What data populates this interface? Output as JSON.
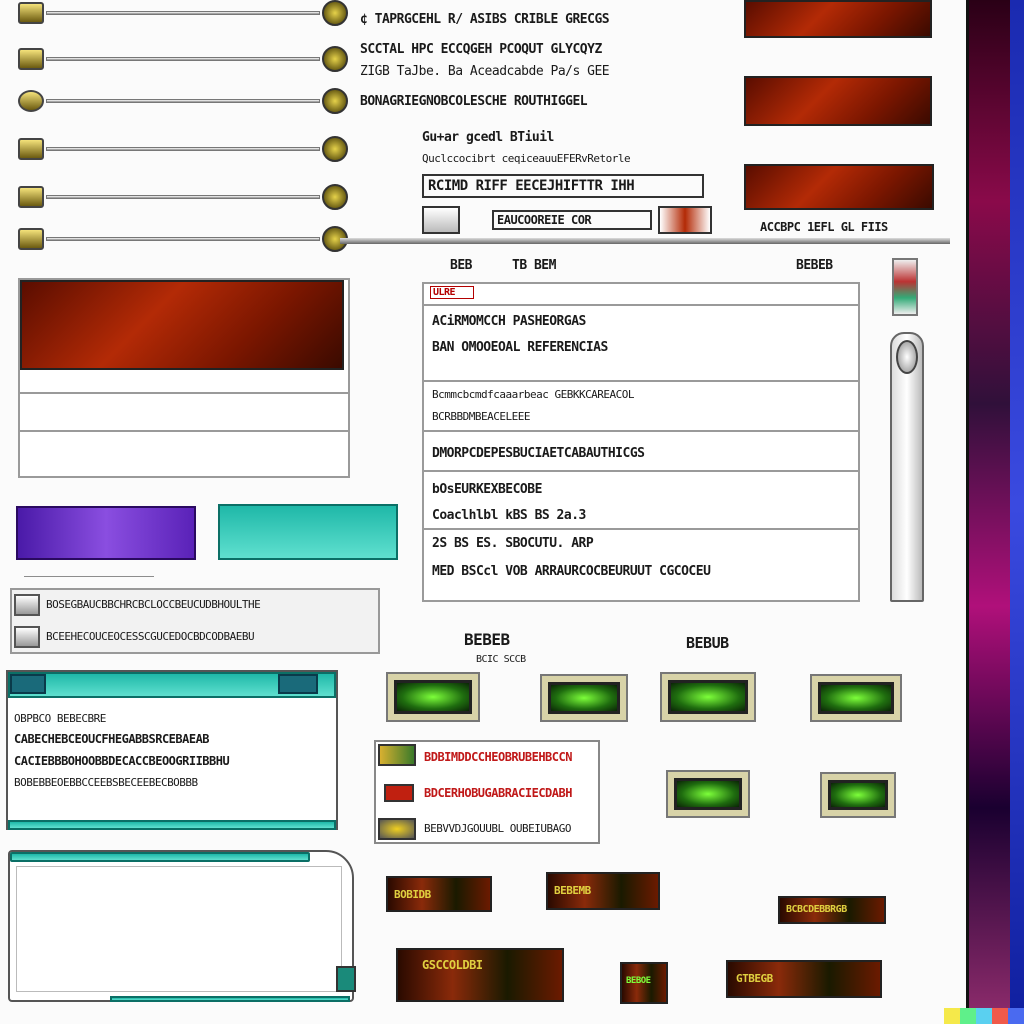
{
  "top_text": {
    "line1": "¢ TAPRGCEHL R/ ASIBS CRIBLE GRECGS",
    "line2": "SCCTAL HPC ECCQGEH PCOQUT GLYCQYZ",
    "line3": "ZIGB TaJbe. Ba Aceadcabde Pa/s GEE",
    "line4": "BONAGRIEGNOBCOLESCHE ROUTHIGGEL"
  },
  "mid_labels": {
    "m1": "Gu+ar gcedl BTiuil",
    "m2": "Quclccocibrt   ceqiceauuEFERvRetorle",
    "m3": "RCIMD RIFF EECEJHIFTTR IHH",
    "m4": "EAUCOOREIE COR"
  },
  "right_caption": "ACCBPC 1EFL GL FIIS",
  "main_panel": {
    "header_left": "BEB",
    "header_mid": "TB BEM",
    "header_right": "BEBEB",
    "tag": "ULRE",
    "rows": [
      "ACiRMOMCCH PASHEORGAS",
      "BAN OMOOEOAL REFERENCIAS",
      "Bcmmcbcmdfcaaarbeac GEBKKCAREACOL",
      "BCRBBDMBEACELEEE",
      "DMORPCDEPESBUCIAETCABAUTHICGS",
      "bOsEURKEXBECOBE",
      "Coaclhlbl kBS BS  2a.3",
      "2S BS  ES. SBOCUTU. ARP",
      "MED BSCcl VOB ARRAURCOCBEURUUT  CGCOCEU"
    ]
  },
  "left_list": {
    "row1": "BOSEGBAUCBBCHRCBCLOCCBEUCUDBHOULTHE",
    "row2": "BCEEHECOUCEOCESSCGUCEDOCBDCODBAEBU"
  },
  "bottom_labels": {
    "l1": "BEBEB",
    "l2": "BCIC  SCCB",
    "l3": "BEBUB"
  },
  "red_list": {
    "r1": "BDBIMDDCCHEOBRUBEHBCCN",
    "r2": "BDCERHOBUGABRACIECDABH",
    "r3": "BEBVVDJGOUUBL OUBEIUBAGO"
  },
  "teal_window": {
    "lines": [
      "OBPBCO                   BEBECBRE",
      "CABECHEBCEOUCFHEGABBSRCEBAEAB",
      "CACIEBBBOHOOBBDECACCBEOOGRIIBBHU",
      "BOBEBBEOEBBCCEEBSBECEEBECBOBBB"
    ]
  },
  "dark_buttons": {
    "b1": "BOBIDB",
    "b2": "BEBEMB",
    "b3": "BCBCDEBBRGB",
    "b4": "GSCCOLDBI",
    "b5": "BEBOE",
    "b6": "GTBEGB"
  },
  "colors": {
    "accent_red": "#b32a06",
    "accent_teal": "#1fb8a8",
    "accent_purple": "#6a34c8",
    "accent_green": "#5fe02a"
  }
}
